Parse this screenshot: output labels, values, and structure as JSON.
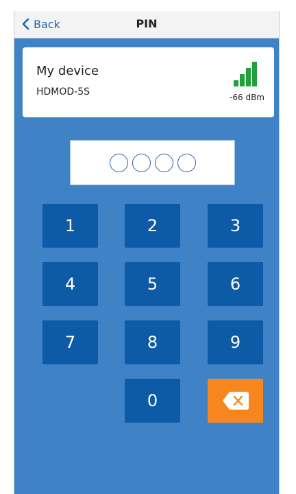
{
  "nav": {
    "back_label": "Back",
    "title": "PIN"
  },
  "device": {
    "name": "My device",
    "model": "HDMOD-5S",
    "signal": "-66 dBm",
    "signal_bars_lit": 4,
    "signal_bars_total": 4
  },
  "pin": {
    "length": 4,
    "entered": 0
  },
  "keypad": {
    "keys": [
      "1",
      "2",
      "3",
      "4",
      "5",
      "6",
      "7",
      "8",
      "9",
      "0"
    ],
    "backspace_icon": "backspace-icon"
  },
  "colors": {
    "background": "#3f82c6",
    "key": "#0d5aa7",
    "backspace": "#f7861f",
    "signal": "#22a13b",
    "link": "#1f64b4"
  }
}
